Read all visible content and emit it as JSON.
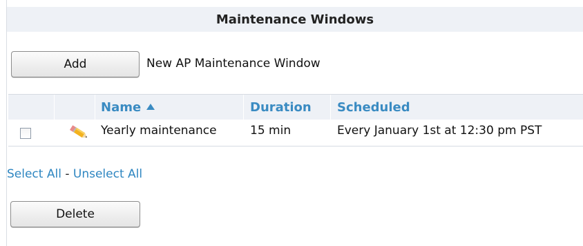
{
  "panel": {
    "title": "Maintenance Windows"
  },
  "add": {
    "button_label": "Add",
    "description": "New AP Maintenance Window"
  },
  "table": {
    "headers": {
      "name": "Name",
      "duration": "Duration",
      "scheduled": "Scheduled"
    },
    "sort": {
      "column": "name",
      "direction": "ascending"
    },
    "rows": [
      {
        "checked": false,
        "name": "Yearly maintenance",
        "duration": "15 min",
        "scheduled": "Every January 1st at 12:30 pm PST"
      }
    ]
  },
  "selection": {
    "select_all": "Select All",
    "separator": " - ",
    "unselect_all": "Unselect All"
  },
  "delete": {
    "button_label": "Delete"
  },
  "icons": {
    "sort": "sort-ascending-icon",
    "edit": "pencil-icon"
  },
  "colors": {
    "link": "#2e86c1",
    "header_text": "#3a8bc2",
    "header_bg": "#eef1f6"
  }
}
